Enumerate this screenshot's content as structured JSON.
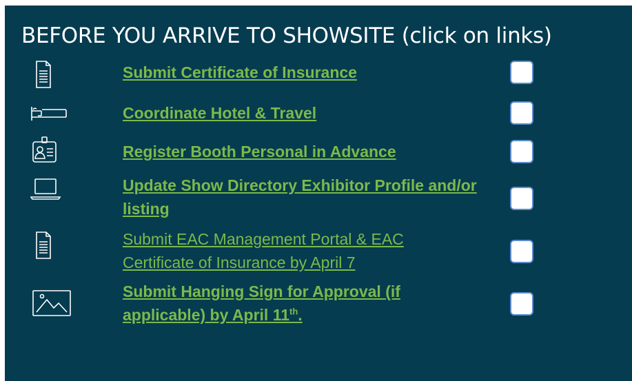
{
  "title": "BEFORE YOU ARRIVE TO SHOWSITE (click on links)",
  "colors": {
    "panel_bg": "#063c4f",
    "link": "#7cb94b",
    "title": "#ffffff",
    "checkbox_border": "#5b8bd0"
  },
  "items": [
    {
      "icon": "document-icon",
      "label": "Submit Certificate of Insurance",
      "checked": false
    },
    {
      "icon": "bed-icon",
      "label": "Coordinate Hotel & Travel",
      "checked": false
    },
    {
      "icon": "id-badge-icon",
      "label": "Register Booth Personal in Advance",
      "checked": false
    },
    {
      "icon": "laptop-icon",
      "label": "Update Show Directory Exhibitor Profile and/or listing",
      "checked": false
    },
    {
      "icon": "document-icon",
      "label": "Submit EAC Management Portal & EAC Certificate of Insurance by April 7",
      "checked": false
    },
    {
      "icon": "image-icon",
      "label": "Submit Hanging Sign for Approval (if applicable) by April 11",
      "label_suffix_sup": "th",
      "label_suffix": ".",
      "checked": false
    }
  ]
}
